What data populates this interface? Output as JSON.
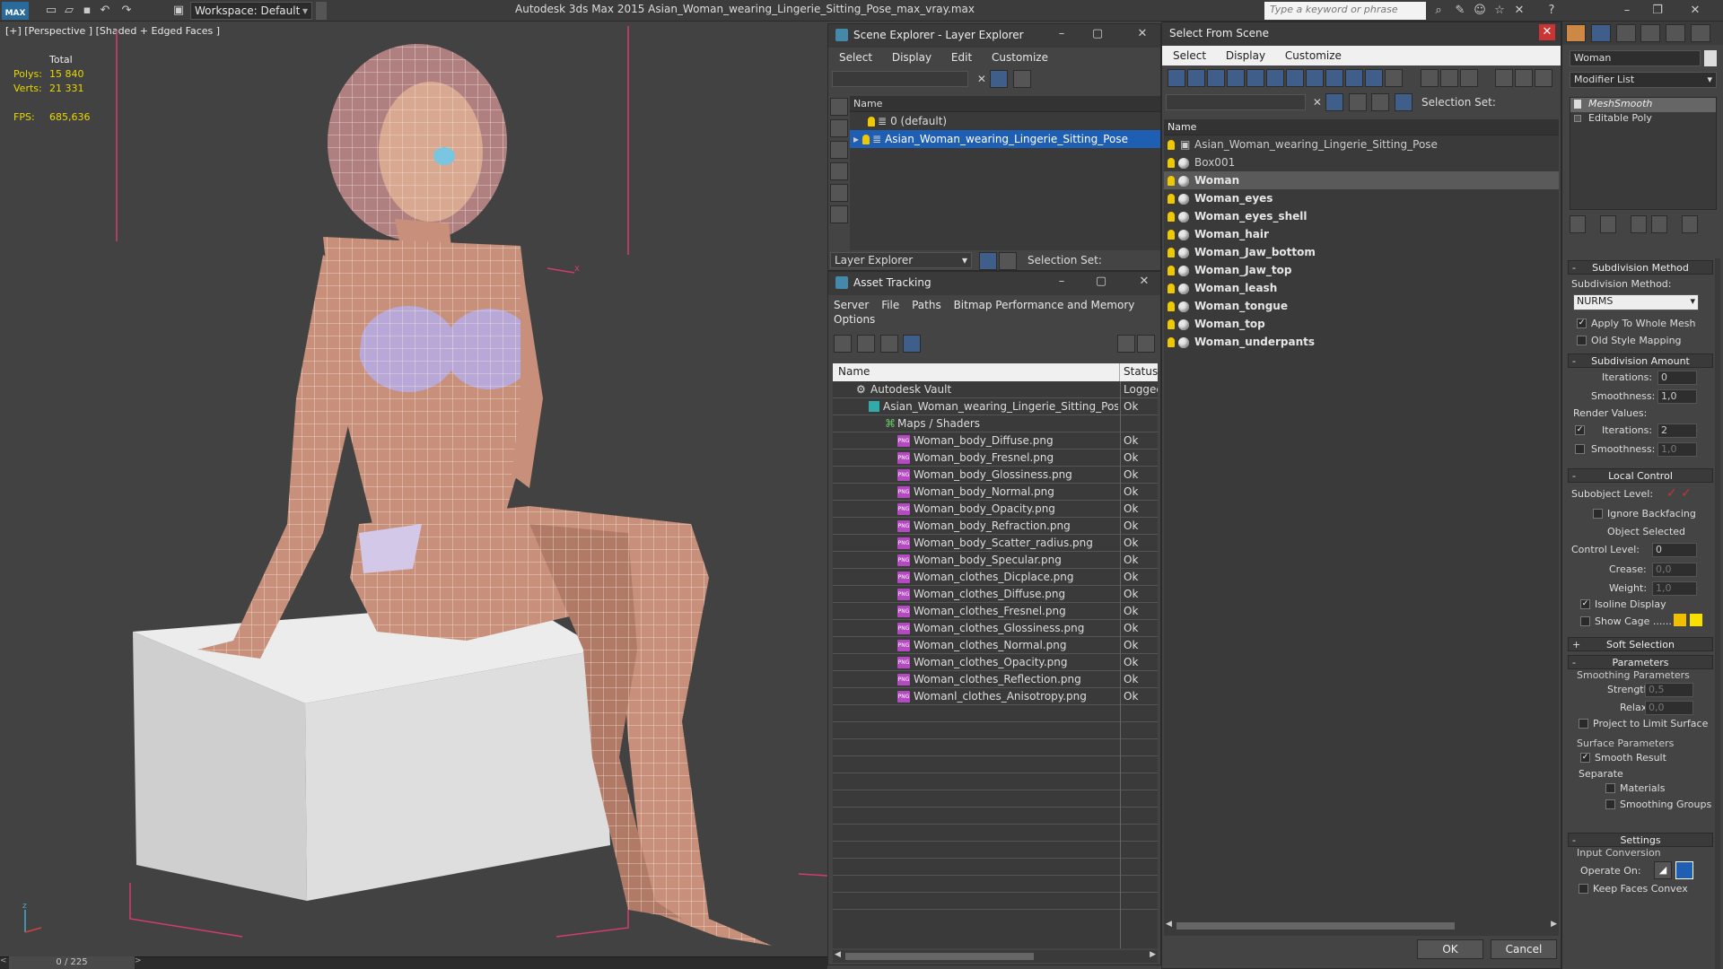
{
  "titlebar": {
    "app_logo": "MAX",
    "workspace": "Workspace: Default",
    "title": "Autodesk 3ds Max  2015     Asian_Woman_wearing_Lingerie_Sitting_Pose_max_vray.max",
    "search_placeholder": "Type a keyword or phrase"
  },
  "viewport": {
    "label": "[+] [Perspective ] [Shaded + Edged Faces ]",
    "stats": {
      "total_label": "Total",
      "polys_label": "Polys:",
      "polys": "15 840",
      "verts_label": "Verts:",
      "verts": "21 331",
      "fps_label": "FPS:",
      "fps": "685,636"
    },
    "time_slider": "0 / 225",
    "axis_x": "x",
    "axis_z": "z"
  },
  "scene_explorer": {
    "title": "Scene Explorer - Layer Explorer",
    "menu": [
      "Select",
      "Display",
      "Edit",
      "Customize"
    ],
    "col_name": "Name",
    "layers": [
      "0 (default)",
      "Asian_Woman_wearing_Lingerie_Sitting_Pose"
    ],
    "footer_select": "Layer Explorer",
    "selection_set": "Selection Set:"
  },
  "asset_tracking": {
    "title": "Asset Tracking",
    "menu": [
      "Server",
      "File",
      "Paths",
      "Bitmap Performance and Memory"
    ],
    "menu2": "Options",
    "col_name": "Name",
    "col_status": "Status",
    "vault": {
      "name": "Autodesk Vault",
      "status": "Logged"
    },
    "file": {
      "name": "Asian_Woman_wearing_Lingerie_Sitting_Pose_...",
      "status": "Ok"
    },
    "maps_folder": "Maps / Shaders",
    "maps": [
      {
        "name": "Woman_body_Diffuse.png",
        "status": "Ok"
      },
      {
        "name": "Woman_body_Fresnel.png",
        "status": "Ok"
      },
      {
        "name": "Woman_body_Glossiness.png",
        "status": "Ok"
      },
      {
        "name": "Woman_body_Normal.png",
        "status": "Ok"
      },
      {
        "name": "Woman_body_Opacity.png",
        "status": "Ok"
      },
      {
        "name": "Woman_body_Refraction.png",
        "status": "Ok"
      },
      {
        "name": "Woman_body_Scatter_radius.png",
        "status": "Ok"
      },
      {
        "name": "Woman_body_Specular.png",
        "status": "Ok"
      },
      {
        "name": "Woman_clothes_Dicplace.png",
        "status": "Ok"
      },
      {
        "name": "Woman_clothes_Diffuse.png",
        "status": "Ok"
      },
      {
        "name": "Woman_clothes_Fresnel.png",
        "status": "Ok"
      },
      {
        "name": "Woman_clothes_Glossiness.png",
        "status": "Ok"
      },
      {
        "name": "Woman_clothes_Normal.png",
        "status": "Ok"
      },
      {
        "name": "Woman_clothes_Opacity.png",
        "status": "Ok"
      },
      {
        "name": "Woman_clothes_Reflection.png",
        "status": "Ok"
      },
      {
        "name": "Womanl_clothes_Anisotropy.png",
        "status": "Ok"
      }
    ],
    "png_badge": "PNG"
  },
  "select_from_scene": {
    "title": "Select From Scene",
    "menu": [
      "Select",
      "Display",
      "Customize"
    ],
    "selection_set": "Selection Set:",
    "col_name": "Name",
    "objects": [
      {
        "name": "Asian_Woman_wearing_Lingerie_Sitting_Pose",
        "bold": false
      },
      {
        "name": "Box001",
        "bold": false
      },
      {
        "name": "Woman",
        "bold": true,
        "selected": true
      },
      {
        "name": "Woman_eyes",
        "bold": true
      },
      {
        "name": "Woman_eyes_shell",
        "bold": true
      },
      {
        "name": "Woman_hair",
        "bold": true
      },
      {
        "name": "Woman_Jaw_bottom",
        "bold": true
      },
      {
        "name": "Woman_Jaw_top",
        "bold": true
      },
      {
        "name": "Woman_leash",
        "bold": true
      },
      {
        "name": "Woman_tongue",
        "bold": true
      },
      {
        "name": "Woman_top",
        "bold": true
      },
      {
        "name": "Woman_underpants",
        "bold": true
      }
    ],
    "ok": "OK",
    "cancel": "Cancel"
  },
  "modifier_panel": {
    "object_name": "Woman",
    "modifier_list": "Modifier List",
    "stack": [
      "MeshSmooth",
      "Editable Poly"
    ],
    "subdivision_method": {
      "header": "Subdivision Method",
      "label": "Subdivision Method:",
      "value": "NURMS",
      "apply_whole_mesh": "Apply To Whole Mesh",
      "old_style_mapping": "Old Style Mapping"
    },
    "subdivision_amount": {
      "header": "Subdivision Amount",
      "iterations_label": "Iterations:",
      "iterations": "0",
      "smoothness_label": "Smoothness:",
      "smoothness": "1,0",
      "render_values": "Render Values:",
      "r_iterations_label": "Iterations:",
      "r_iterations": "2",
      "r_smoothness_label": "Smoothness:",
      "r_smoothness": "1,0"
    },
    "local_control": {
      "header": "Local Control",
      "subobject_label": "Subobject Level:",
      "ignore_backfacing": "Ignore Backfacing",
      "object_selected": "Object Selected",
      "control_level_label": "Control Level:",
      "control_level": "0",
      "crease_label": "Crease:",
      "crease": "0,0",
      "weight_label": "Weight:",
      "weight": "1,0",
      "isoline_display": "Isoline Display",
      "show_cage": "Show Cage ......"
    },
    "soft_selection": {
      "header": "Soft Selection"
    },
    "parameters": {
      "header": "Parameters",
      "smoothing_parameters": "Smoothing Parameters",
      "strength_label": "Strength:",
      "strength": "0,5",
      "relax_label": "Relax:",
      "relax": "0,0",
      "project_limit": "Project to Limit Surface",
      "surface_parameters": "Surface Parameters",
      "smooth_result": "Smooth Result",
      "separate": "Separate",
      "materials": "Materials",
      "smoothing_groups": "Smoothing Groups"
    },
    "settings": {
      "header": "Settings",
      "input_conversion": "Input Conversion",
      "operate_on": "Operate On:",
      "keep_faces_convex": "Keep Faces Convex"
    }
  },
  "colors": {
    "accent": "#1e5fb4",
    "bulb": "#f0c800",
    "wire": "#ffffff",
    "skin": "#c8907a",
    "box": "#d9d9d9",
    "bbox_corner": "#d23c6e"
  }
}
